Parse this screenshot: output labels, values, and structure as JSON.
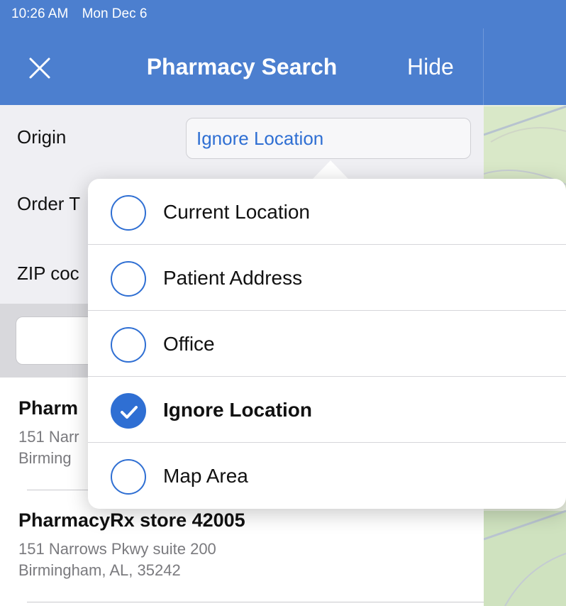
{
  "status_bar": {
    "time": "10:26 AM",
    "date": "Mon Dec 6"
  },
  "nav": {
    "title": "Pharmacy Search",
    "hide_label": "Hide",
    "close_icon": "close-icon"
  },
  "form": {
    "origin_label": "Origin",
    "origin_value": "Ignore Location",
    "order_type_label": "Order T",
    "zip_label": "ZIP coc"
  },
  "results": [
    {
      "name": "Pharm",
      "address_line1": "151 Narr",
      "address_line2": "Birming"
    },
    {
      "name": "PharmacyRx store 42005",
      "address_line1": "151 Narrows Pkwy suite 200",
      "address_line2": "Birmingham, AL, 35242"
    }
  ],
  "origin_options": [
    {
      "label": "Current Location",
      "selected": false
    },
    {
      "label": "Patient Address",
      "selected": false
    },
    {
      "label": "Office",
      "selected": false
    },
    {
      "label": "Ignore Location",
      "selected": true
    },
    {
      "label": "Map Area",
      "selected": false
    }
  ],
  "colors": {
    "nav_blue": "#4c7fcf",
    "accent_blue": "#2f6fd3"
  }
}
